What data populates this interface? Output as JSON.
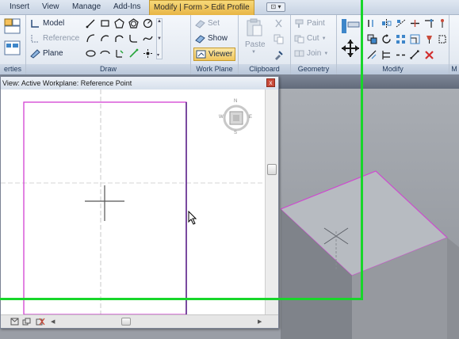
{
  "menu": {
    "tabs": [
      "Insert",
      "View",
      "Manage",
      "Add-Ins"
    ],
    "active_tab": "Modify | Form > Edit Profile",
    "qat_label": "⊡ ▾"
  },
  "ribbon": {
    "panels": {
      "properties": "erties",
      "draw": "Draw",
      "work_plane": "Work Plane",
      "clipboard": "Clipboard",
      "geometry": "Geometry",
      "modify": "Modify",
      "more": "M"
    },
    "draw": {
      "model": "Model",
      "reference": "Reference",
      "plane": "Plane"
    },
    "work_plane": {
      "set": "Set",
      "show": "Show",
      "viewer": "Viewer"
    },
    "clipboard": {
      "paste": "Paste"
    },
    "geometry": {
      "paint": "Paint",
      "cut": "Cut",
      "join": "Join"
    }
  },
  "dialog": {
    "title": "View: Active Workplane: Reference Point",
    "close": "x"
  },
  "viewcube": {
    "n": "N",
    "e": "E",
    "s": "S",
    "w": "W"
  },
  "colors": {
    "accent_green": "#18d62a",
    "profile_magenta": "#d33fd3",
    "ribbon_active": "#f2c85f"
  }
}
